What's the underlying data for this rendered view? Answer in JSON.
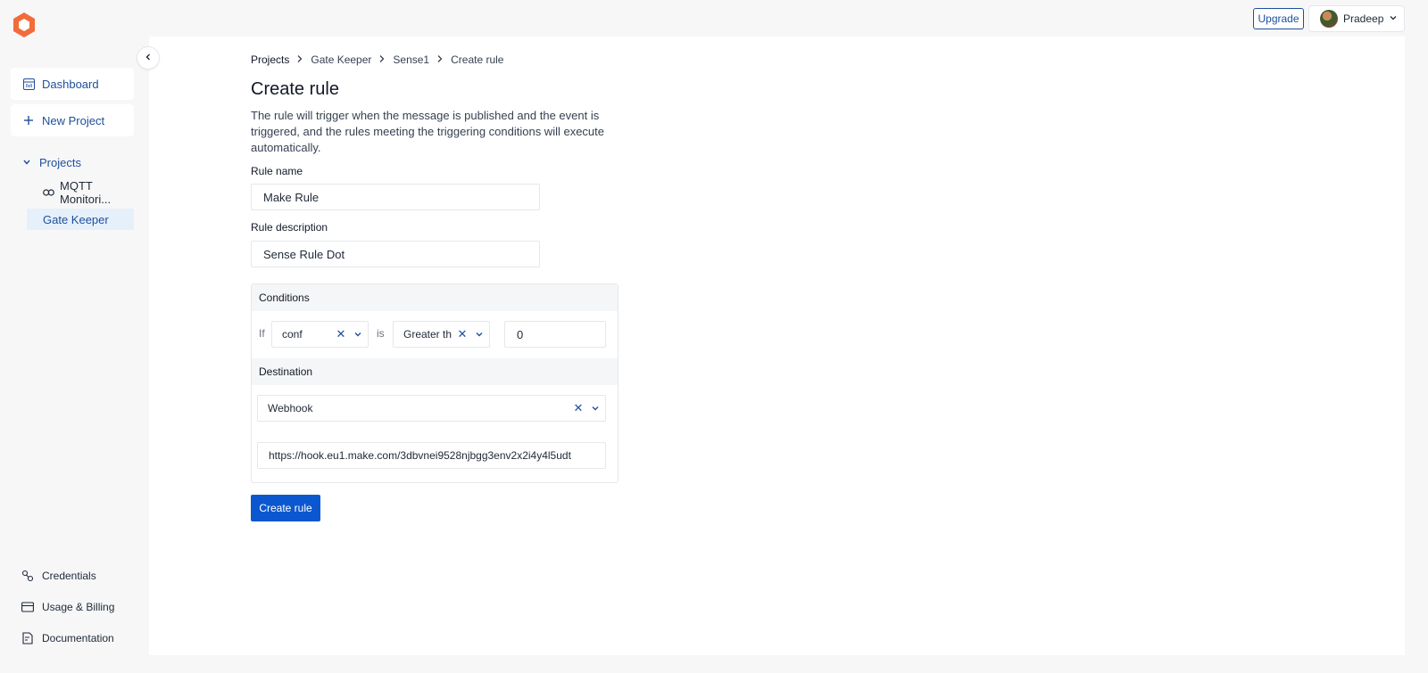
{
  "header": {
    "upgrade_label": "Upgrade",
    "user_name": "Pradeep"
  },
  "sidebar": {
    "dashboard_label": "Dashboard",
    "new_project_label": "New Project",
    "projects_label": "Projects",
    "projects": [
      {
        "label": "MQTT Monitori..."
      },
      {
        "label": "Gate Keeper"
      }
    ],
    "bottom": [
      {
        "label": "Credentials"
      },
      {
        "label": "Usage & Billing"
      },
      {
        "label": "Documentation"
      }
    ]
  },
  "breadcrumb": [
    "Projects",
    "Gate Keeper",
    "Sense1",
    "Create rule"
  ],
  "page": {
    "title": "Create rule",
    "description": "The rule will trigger when the message is published and the event is triggered, and the rules meeting the triggering conditions will execute automatically."
  },
  "form": {
    "rule_name_label": "Rule name",
    "rule_name_value": "Make Rule",
    "rule_description_label": "Rule description",
    "rule_description_value": "Sense Rule Dot",
    "conditions_label": "Conditions",
    "if_label": "If",
    "field_value": "conf",
    "is_label": "is",
    "operator_value": "Greater th",
    "threshold_value": "0",
    "destination_label": "Destination",
    "destination_value": "Webhook",
    "webhook_url": "https://hook.eu1.make.com/3dbvnei9528njbgg3env2x2i4y4l5udt",
    "create_label": "Create rule"
  },
  "colors": {
    "accent": "#1e4f9c",
    "primary_button": "#0b57d0",
    "logo": "#f26b3a"
  }
}
